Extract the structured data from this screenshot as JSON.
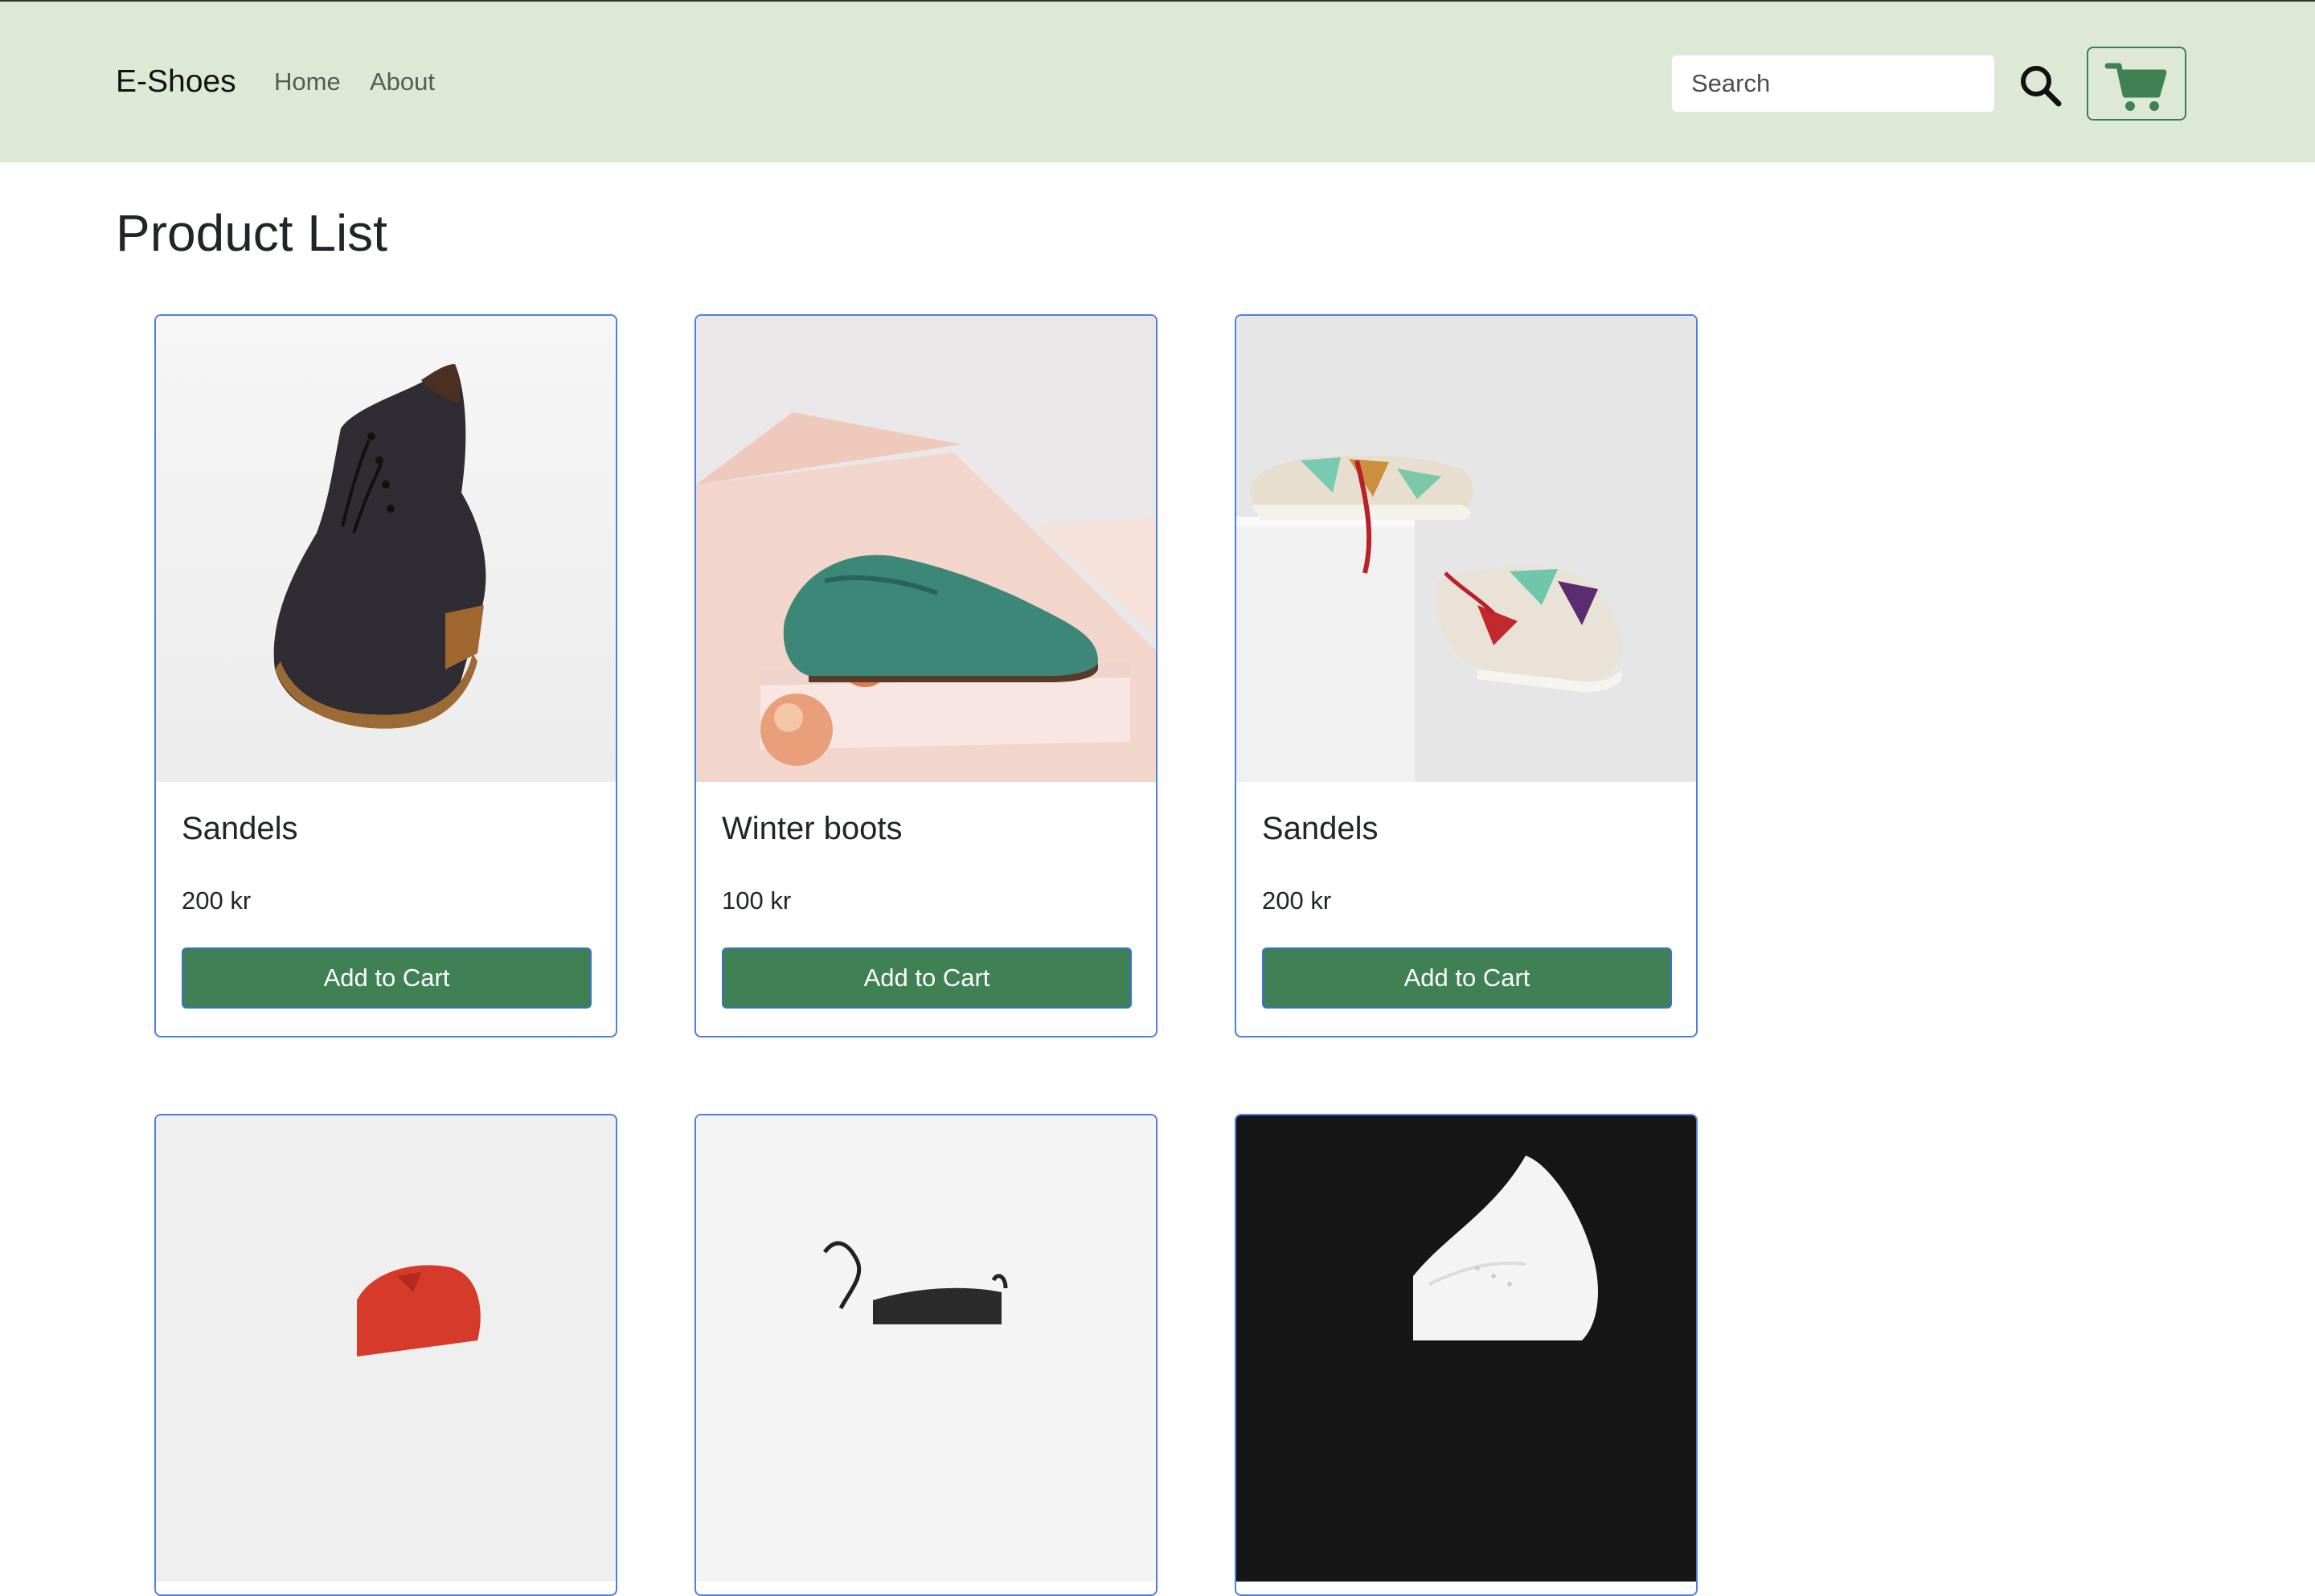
{
  "navbar": {
    "brand": "E-Shoes",
    "links": [
      "Home",
      "About"
    ],
    "search_placeholder": "Search",
    "search_icon": "search-icon",
    "cart_icon": "cart-icon",
    "colors": {
      "background": "#dde9d5",
      "accent": "#3f8155"
    }
  },
  "main": {
    "title": "Product List",
    "products": [
      {
        "name": "Sandels",
        "price": "200 kr",
        "button": "Add to Cart",
        "image": "dark-chukka-boot"
      },
      {
        "name": "Winter boots",
        "price": "100 kr",
        "button": "Add to Cart",
        "image": "green-brogue-shoe"
      },
      {
        "name": "Sandels",
        "price": "200 kr",
        "button": "Add to Cart",
        "image": "colorful-sneakers-pair"
      },
      {
        "image": "red-sneaker"
      },
      {
        "image": "black-sneaker"
      },
      {
        "image": "white-sneaker-dark-bg"
      }
    ]
  }
}
